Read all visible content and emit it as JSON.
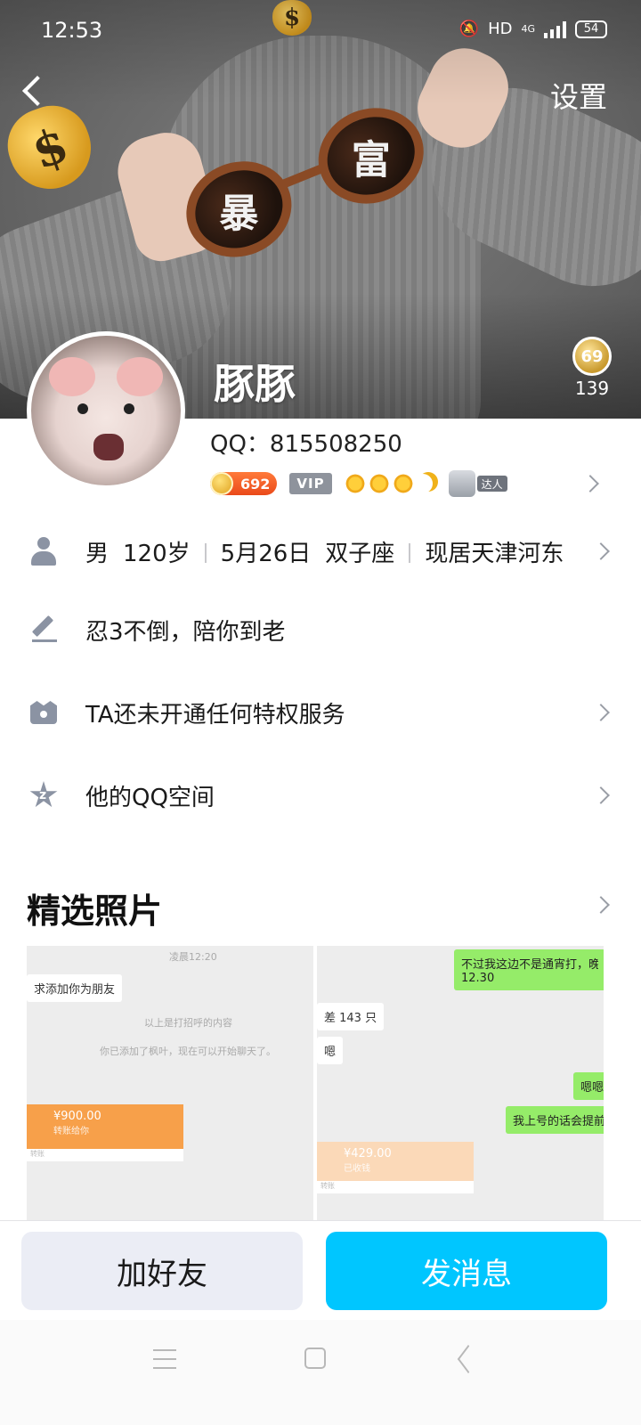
{
  "status_bar": {
    "time": "12:53",
    "network": "HD",
    "signal_type": "4G",
    "battery": "54"
  },
  "header": {
    "back_icon": "chevron-left-icon",
    "settings_label": "设置",
    "cover_text_1": "暴",
    "cover_text_2": "富",
    "money_symbol": "$"
  },
  "profile": {
    "nickname": "豚豚",
    "qq_label": "QQ：815508250",
    "like_level": "69",
    "like_count": "139",
    "coin_value": "692",
    "vip_label": "VIP",
    "daren_label": "达人"
  },
  "info_rows": {
    "basic": {
      "gender": "男",
      "age": "120岁",
      "birthday": "5月26日",
      "zodiac": "双子座",
      "location": "现居天津河东"
    },
    "signature": "忍3不倒，陪你到老",
    "privilege": "TA还未开通任何特权服务",
    "qzone": "他的QQ空间"
  },
  "photos_section": {
    "title": "精选照片",
    "photo1": {
      "time": "凌晨12:20",
      "request": "求添加你为朋友",
      "sys1": "以上是打招呼的内容",
      "sys2": "你已添加了枫叶，现在可以开始聊天了。",
      "amount": "¥900.00",
      "amount_note": "转账给你",
      "footer": "转账"
    },
    "photo2": {
      "green1_line1": "不过我这边不是通宵打，晚上",
      "green1_line2": "12.30",
      "white1": "差 143 只",
      "white2": "嗯",
      "green2": "嗯嗯",
      "green3": "我上号的话会提前",
      "amount": "¥429.00",
      "amount_note": "已收钱",
      "footer": "转账"
    }
  },
  "actions": {
    "add_friend": "加好友",
    "send_message": "发消息"
  }
}
